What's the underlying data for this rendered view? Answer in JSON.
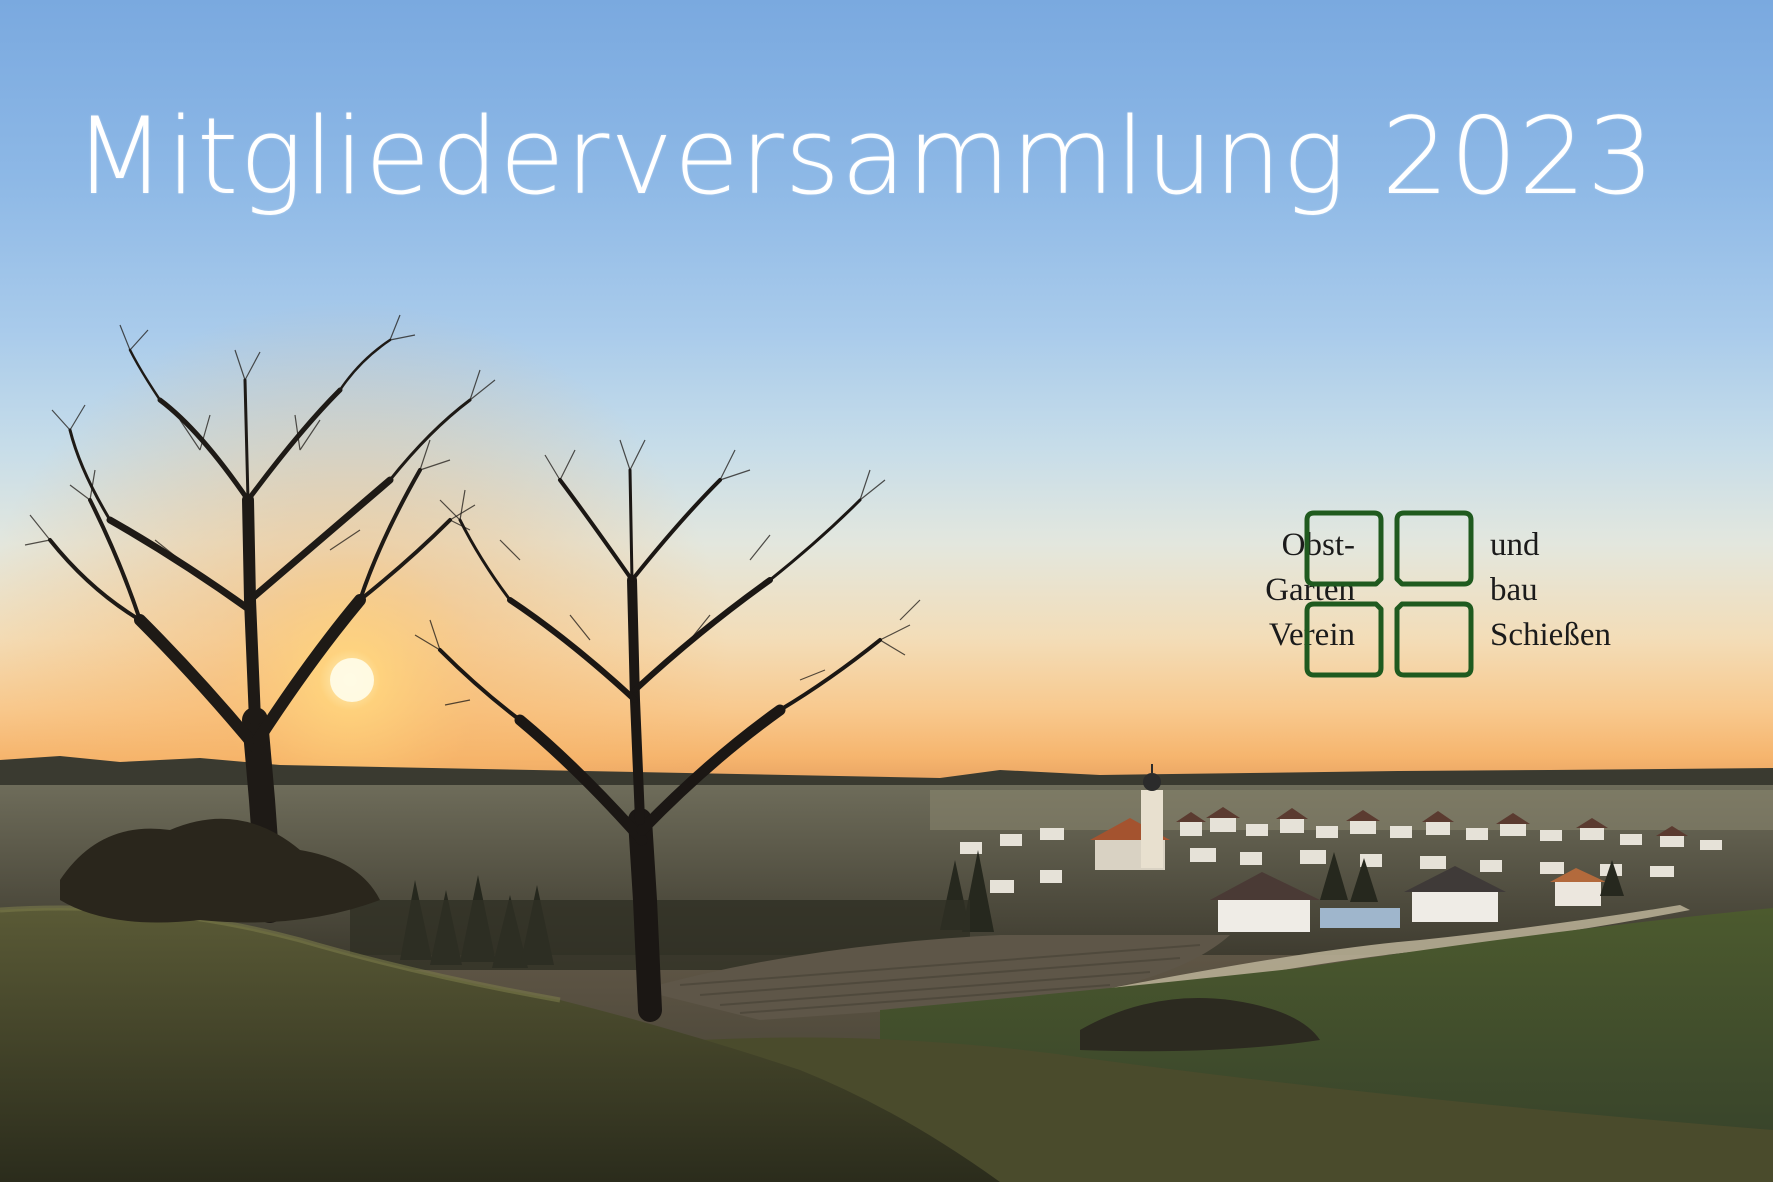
{
  "title": "Mitgliederversammlung 2023",
  "logo": {
    "left_words": [
      "Obst-",
      "Garten",
      "Verein"
    ],
    "right_words": [
      "und",
      "bau",
      "Schießen"
    ],
    "color": "#1f5a1f"
  },
  "palette": {
    "sky_top": "#7aa9df",
    "horizon_glow": "#f6b56e",
    "meadow": "#3e4a2a"
  }
}
